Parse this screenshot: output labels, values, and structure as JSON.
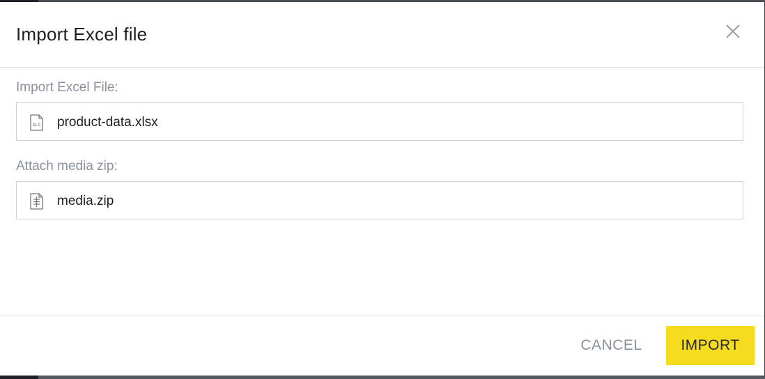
{
  "dialog": {
    "title": "Import Excel file",
    "close_icon": "close-icon"
  },
  "fields": [
    {
      "label": "Import Excel File:",
      "file_name": "product-data.xlsx",
      "icon": "xls-file-icon"
    },
    {
      "label": "Attach media zip:",
      "file_name": "media.zip",
      "icon": "zip-file-icon"
    }
  ],
  "footer": {
    "cancel_label": "CANCEL",
    "import_label": "IMPORT"
  },
  "colors": {
    "accent": "#f5dc1e",
    "label_text": "#8a929b",
    "backdrop": "#3a3d42"
  }
}
